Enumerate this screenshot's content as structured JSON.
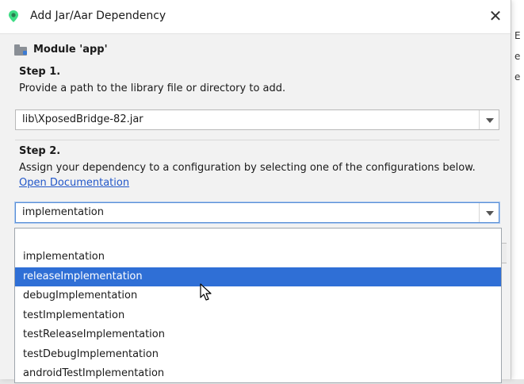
{
  "window": {
    "title": "Add Jar/Aar Dependency",
    "close_glyph": "✕"
  },
  "module": {
    "label": "Module 'app'"
  },
  "step1": {
    "title": "Step 1.",
    "description": "Provide a path to the library file or directory to add.",
    "path_value": "lib\\XposedBridge-82.jar"
  },
  "step2": {
    "title": "Step 2.",
    "description": "Assign your dependency to a configuration by selecting one of the configurations below.",
    "link": "Open Documentation",
    "selected_value": "implementation"
  },
  "dropdown": {
    "options": [
      "implementation",
      "releaseImplementation",
      "debugImplementation",
      "testImplementation",
      "testReleaseImplementation",
      "testDebugImplementation",
      "androidTestImplementation"
    ],
    "highlighted_index": 1
  },
  "colors": {
    "highlight": "#2f6fd6",
    "link": "#2257c9",
    "focus_border": "#5a8fd6"
  },
  "icons": {
    "app": "android-studio-icon",
    "module": "module-folder-icon",
    "dropdown": "chevron-down-icon",
    "cursor": "mouse-pointer-icon"
  }
}
